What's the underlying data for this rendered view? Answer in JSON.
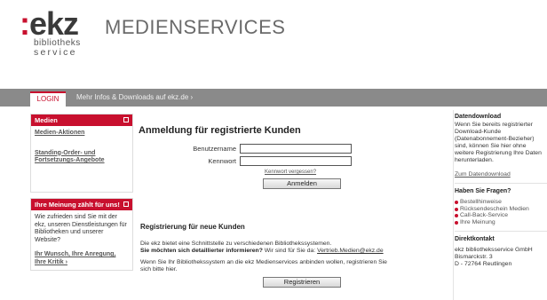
{
  "header": {
    "logo_colon": ":",
    "logo_text": "ekz",
    "logo_sub1": "bibliotheks",
    "logo_sub2": "service",
    "title": "MEDIENSERVICES"
  },
  "nav": {
    "login": "LOGIN",
    "more": "Mehr Infos & Downloads auf ekz.de ›"
  },
  "left": {
    "medien": {
      "title": "Medien",
      "link1": "Medien-Aktionen",
      "link2": "Standing-Order- und Fortsetzungs-Angebote"
    },
    "meinung": {
      "title": "Ihre Meinung zählt für uns!",
      "text": "Wie zufrieden sind Sie mit der ekz, unseren Dienstleistungen für Bibliotheken und unserer Website?",
      "link": "Ihr Wunsch, Ihre Anregung, Ihre Kritik ›"
    }
  },
  "main": {
    "title": "Anmeldung für registrierte Kunden",
    "username_label": "Benutzername",
    "password_label": "Kennwort",
    "username_value": "",
    "password_value": "",
    "forgot": "Kennwort vergessen?",
    "login_button": "Anmelden",
    "reg_title": "Registrierung für neue Kunden",
    "reg_text1": "Die ekz bietet eine Schnittstelle zu verschiedenen Bibliothekssystemen.",
    "reg_text2_bold": "Sie möchten sich detaillierter informieren?",
    "reg_text2_rest": " Wir sind für Sie da: ",
    "reg_email": "Vertrieb.Medien@ekz.de",
    "reg_text3": "Wenn Sie Ihr Bibliothekssystem an die ekz Medienservices anbinden wollen, registrieren Sie sich bitte hier.",
    "register_button": "Registrieren"
  },
  "right": {
    "download_title": "Datendownload",
    "download_text": "Wenn Sie bereits registrierter Download-Kunde (Datenabonnement-Bezieher) sind, können Sie hier ohne weitere Registrierung Ihre Daten herunterladen.",
    "download_link": "Zum Datendownload",
    "questions_title": "Haben Sie Fragen?",
    "questions": [
      "Bestellhinweise",
      "Rücksendeschein Medien",
      "Call-Back-Service",
      "Ihre Meinung"
    ],
    "contact_title": "Direktkontakt",
    "contact_line1": "ekz bibliotheksservice GmbH",
    "contact_line2": "Bismarckstr. 3",
    "contact_line3": "D - 72764 Reutlingen"
  },
  "colors": {
    "accent": "#c8102e",
    "navbar": "#8a8a8a"
  }
}
